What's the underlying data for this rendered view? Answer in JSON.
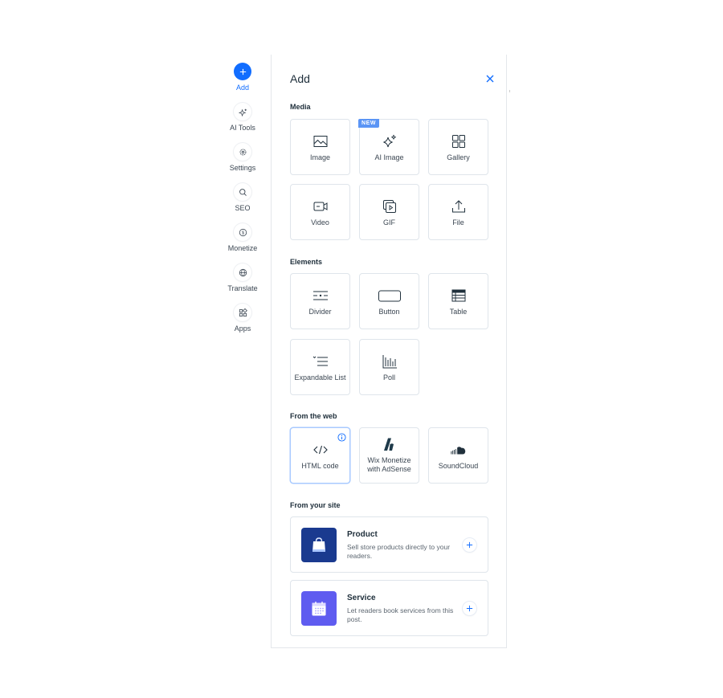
{
  "rail": {
    "items": [
      {
        "label": "Add",
        "icon": "plus-icon",
        "active": true
      },
      {
        "label": "AI Tools",
        "icon": "sparkle-icon"
      },
      {
        "label": "Settings",
        "icon": "gear-icon"
      },
      {
        "label": "SEO",
        "icon": "search-icon"
      },
      {
        "label": "Monetize",
        "icon": "dollar-coin-icon"
      },
      {
        "label": "Translate",
        "icon": "globe-icon"
      },
      {
        "label": "Apps",
        "icon": "apps-icon"
      }
    ]
  },
  "panel": {
    "title": "Add",
    "close_icon": "close-icon",
    "sections": {
      "media": {
        "title": "Media",
        "tiles": [
          {
            "label": "Image",
            "icon": "image-icon"
          },
          {
            "label": "AI Image",
            "icon": "sparkle-icon",
            "badge": "NEW"
          },
          {
            "label": "Gallery",
            "icon": "grid-icon"
          },
          {
            "label": "Video",
            "icon": "video-camera-icon"
          },
          {
            "label": "GIF",
            "icon": "gif-icon"
          },
          {
            "label": "File",
            "icon": "upload-icon"
          }
        ]
      },
      "elements": {
        "title": "Elements",
        "tiles": [
          {
            "label": "Divider",
            "icon": "divider-icon"
          },
          {
            "label": "Button",
            "icon": "button-icon"
          },
          {
            "label": "Table",
            "icon": "table-icon"
          },
          {
            "label": "Expandable List",
            "icon": "expandable-list-icon"
          },
          {
            "label": "Poll",
            "icon": "poll-icon"
          }
        ]
      },
      "web": {
        "title": "From the web",
        "tiles": [
          {
            "label": "HTML code",
            "icon": "code-icon",
            "selected": true,
            "info_icon": "info-icon"
          },
          {
            "label": "Wix Monetize\nwith AdSense",
            "line1": "Wix Monetize",
            "line2": "with AdSense",
            "icon": "adsense-icon"
          },
          {
            "label": "SoundCloud",
            "icon": "soundcloud-icon"
          }
        ]
      },
      "site": {
        "title": "From your site",
        "cards": [
          {
            "title": "Product",
            "description": "Sell store products directly to your readers.",
            "icon": "shopping-bag-icon",
            "color": "#1a3a8f"
          },
          {
            "title": "Service",
            "description": "Let readers book services from this post.",
            "icon": "calendar-icon",
            "color": "#5f5cf0"
          }
        ]
      }
    }
  },
  "colors": {
    "accent": "#116dff",
    "badge": "#5b95f5",
    "product": "#1a3a8f",
    "service": "#5f5cf0"
  }
}
